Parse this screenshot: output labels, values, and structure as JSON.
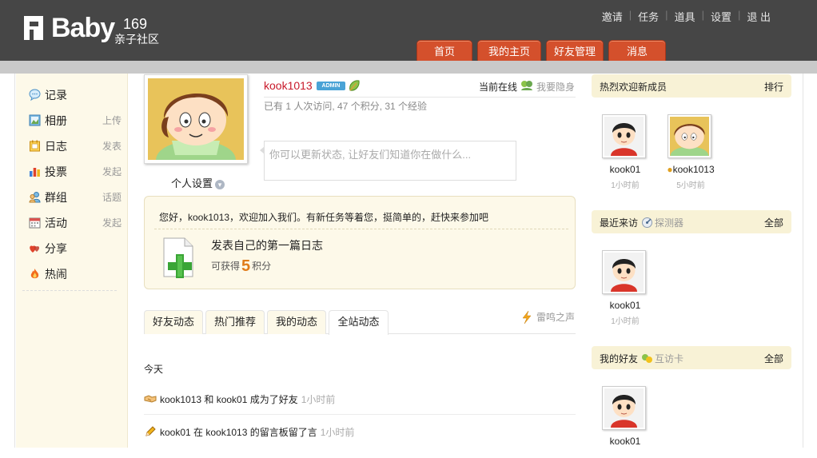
{
  "logo": {
    "text": "Baby",
    "number": "169",
    "subtitle": "亲子社区"
  },
  "top_links": [
    "邀请",
    "任务",
    "道具",
    "设置",
    "退 出"
  ],
  "nav": {
    "home": "首页",
    "my_home": "我的主页",
    "friends": "好友管理",
    "messages": "消息"
  },
  "sidebar": {
    "items": [
      {
        "label": "记录",
        "action": "",
        "icon": "record-icon"
      },
      {
        "label": "相册",
        "action": "上传",
        "icon": "album-icon"
      },
      {
        "label": "日志",
        "action": "发表",
        "icon": "diary-icon"
      },
      {
        "label": "投票",
        "action": "发起",
        "icon": "vote-icon"
      },
      {
        "label": "群组",
        "action": "话题",
        "icon": "group-icon"
      },
      {
        "label": "活动",
        "action": "发起",
        "icon": "event-icon"
      },
      {
        "label": "分享",
        "action": "",
        "icon": "share-icon"
      },
      {
        "label": "热闹",
        "action": "",
        "icon": "hot-icon"
      }
    ]
  },
  "profile": {
    "settings_label": "个人设置",
    "username": "kook1013",
    "badge": "ADMIN",
    "online_label": "当前在线",
    "hide_label": "我要隐身",
    "stats": "已有 1 人次访问, 47 个积分, 31 个经验",
    "status_placeholder": "你可以更新状态, 让好友们知道你在做什么..."
  },
  "task": {
    "greeting": "您好，kook1013，欢迎加入我们。有新任务等着您，挺简单的，赶快来参加吧",
    "title": "发表自己的第一篇日志",
    "reward_prefix": "可获得",
    "reward_value": "5",
    "reward_suffix": "积分"
  },
  "tabs": {
    "items": [
      "好友动态",
      "热门推荐",
      "我的动态",
      "全站动态"
    ],
    "active": 3,
    "right_label": "雷鸣之声"
  },
  "feed": {
    "day_label": "今天",
    "items": [
      {
        "text": "kook1013 和 kook01 成为了好友",
        "time": "1小时前",
        "icon": "handshake-icon"
      },
      {
        "text": "kook01 在 kook1013 的留言板留了言",
        "time": "1小时前",
        "icon": "pencil-icon"
      }
    ]
  },
  "right": {
    "new_members": {
      "title": "热烈欢迎新成员",
      "more": "排行",
      "members": [
        {
          "name": "kook01",
          "time": "1小时前"
        },
        {
          "name": "kook1013",
          "time": "5小时前"
        }
      ]
    },
    "recent_visitors": {
      "title": "最近来访",
      "sub": "探测器",
      "more": "全部",
      "members": [
        {
          "name": "kook01",
          "time": "1小时前"
        }
      ]
    },
    "my_friends": {
      "title": "我的好友",
      "sub": "互访卡",
      "more": "全部",
      "members": [
        {
          "name": "kook01",
          "time": ""
        }
      ]
    }
  },
  "colors": {
    "header_bg": "#464646",
    "nav_red": "#d4502c",
    "sidebar_bg": "#fdf9e9",
    "username_red": "#c8192a",
    "reward_orange": "#e07b1a"
  }
}
